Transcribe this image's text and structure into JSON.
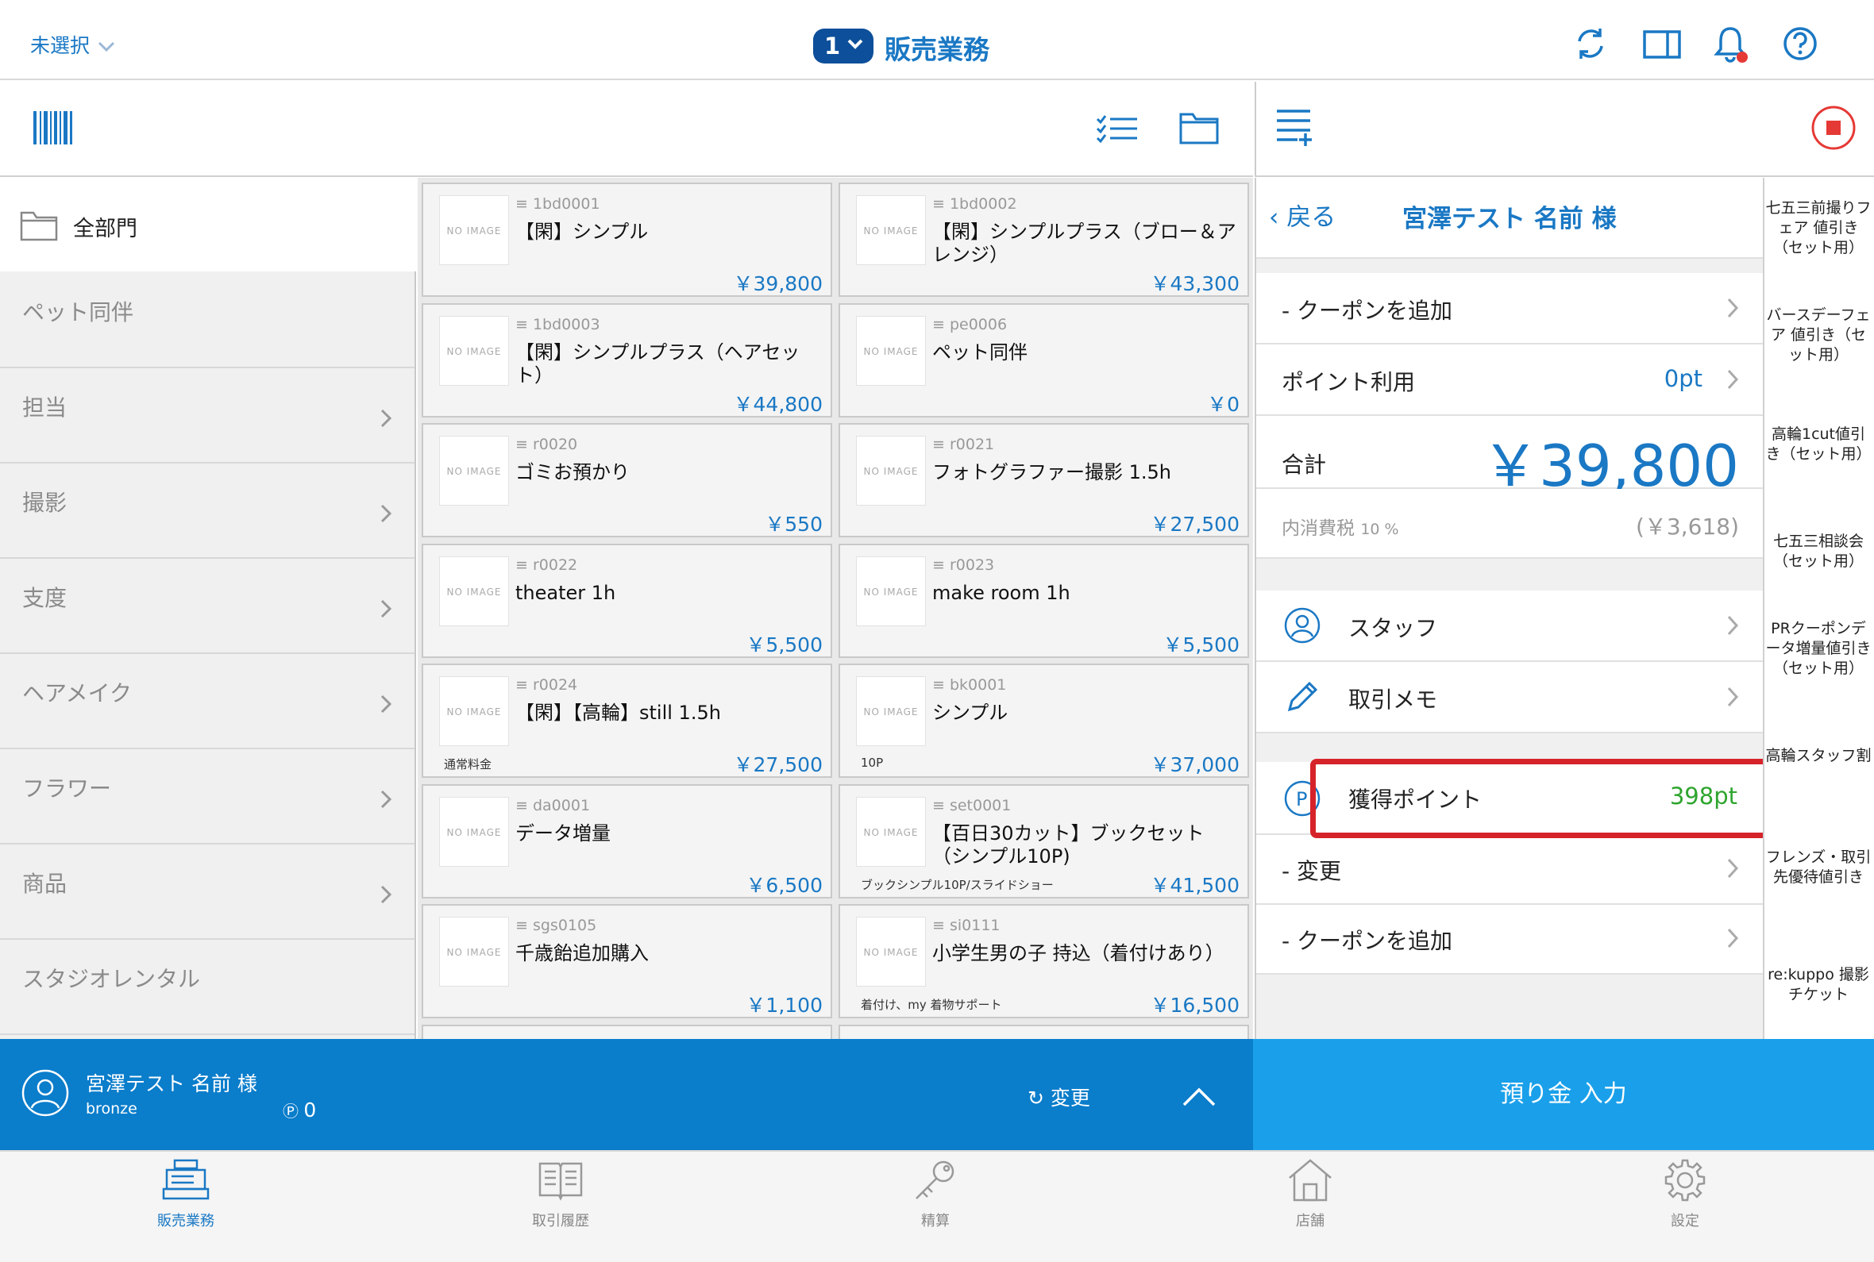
{
  "header": {
    "store_select": "未選択",
    "register_no": "1",
    "title": "販売業務"
  },
  "categories": {
    "all_label": "全部門",
    "items": [
      {
        "label": "ペット同伴",
        "chevron": false
      },
      {
        "label": "担当",
        "chevron": true
      },
      {
        "label": "撮影",
        "chevron": true
      },
      {
        "label": "支度",
        "chevron": true
      },
      {
        "label": "ヘアメイク",
        "chevron": true
      },
      {
        "label": "フラワー",
        "chevron": true
      },
      {
        "label": "商品",
        "chevron": true
      },
      {
        "label": "スタジオレンタル",
        "chevron": false
      }
    ]
  },
  "products": [
    {
      "code": "1bd0001",
      "name": "【閑】シンプル",
      "sub": "",
      "price": "￥39,800",
      "no_image": "NO IMAGE"
    },
    {
      "code": "1bd0002",
      "name": "【閑】シンプルプラス（ブロー＆アレンジ）",
      "sub": "",
      "price": "￥43,300",
      "no_image": "NO IMAGE"
    },
    {
      "code": "1bd0003",
      "name": "【閑】シンプルプラス（ヘアセット）",
      "sub": "",
      "price": "￥44,800",
      "no_image": "NO IMAGE"
    },
    {
      "code": "pe0006",
      "name": "ペット同伴",
      "sub": "",
      "price": "￥0",
      "no_image": "NO IMAGE"
    },
    {
      "code": "r0020",
      "name": "ゴミお預かり",
      "sub": "",
      "price": "￥550",
      "no_image": "NO IMAGE"
    },
    {
      "code": "r0021",
      "name": "フォトグラファー撮影 1.5h",
      "sub": "",
      "price": "￥27,500",
      "no_image": "NO IMAGE"
    },
    {
      "code": "r0022",
      "name": "theater 1h",
      "sub": "",
      "price": "￥5,500",
      "no_image": "NO IMAGE"
    },
    {
      "code": "r0023",
      "name": "make room 1h",
      "sub": "",
      "price": "￥5,500",
      "no_image": "NO IMAGE"
    },
    {
      "code": "r0024",
      "name": "【閑】【高輪】still 1.5h",
      "sub": "通常料金",
      "price": "￥27,500",
      "no_image": "NO IMAGE"
    },
    {
      "code": "bk0001",
      "name": "シンプル",
      "sub": "10P",
      "price": "￥37,000",
      "no_image": "NO IMAGE"
    },
    {
      "code": "da0001",
      "name": "データ増量",
      "sub": "",
      "price": "￥6,500",
      "no_image": "NO IMAGE"
    },
    {
      "code": "set0001",
      "name": "【百日30カット】ブックセット（シンプル10P)",
      "sub": "ブックシンプル10P/スライドショー",
      "price": "￥41,500",
      "no_image": "NO IMAGE"
    },
    {
      "code": "sgs0105",
      "name": "千歳飴追加購入",
      "sub": "",
      "price": "￥1,100",
      "no_image": "NO IMAGE"
    },
    {
      "code": "si0111",
      "name": "小学生男の子 持込（着付けあり）",
      "sub": "着付け、my 着物サポート",
      "price": "￥16,500",
      "no_image": "NO IMAGE"
    }
  ],
  "customer": {
    "name": "宮澤テスト 名前 様",
    "rank": "bronze",
    "points": "0",
    "change_label": "変更"
  },
  "cart": {
    "back_label": "戻る",
    "customer_title": "宮澤テスト 名前 様",
    "coupon_add_1": "- クーポンを追加",
    "points_use_label": "ポイント利用",
    "points_use_value": "0pt",
    "total_label": "合計",
    "total_value": "￥39,800",
    "tax_label": "内消費税",
    "tax_rate": "10 %",
    "tax_value": "(￥3,618)",
    "staff_label": "スタッフ",
    "memo_label": "取引メモ",
    "earned_label": "獲得ポイント",
    "earned_value": "398pt",
    "change_label": "- 変更",
    "coupon_add_2": "- クーポンを追加",
    "deposit_label": "預り金 入力"
  },
  "presets": [
    "七五三前撮りフェア 値引き（セット用）",
    "バースデーフェア 値引き（セット用）",
    "高輪1cut値引き（セット用）",
    "七五三相談会（セット用）",
    "PRクーポンデータ増量値引き（セット用）",
    "高輪スタッフ割",
    "フレンズ・取引先優待値引き",
    "re:kuppo 撮影チケット"
  ],
  "tabs": [
    {
      "label": "販売業務",
      "icon": "register-icon",
      "active": true
    },
    {
      "label": "取引履歴",
      "icon": "book-icon",
      "active": false
    },
    {
      "label": "精算",
      "icon": "key-icon",
      "active": false
    },
    {
      "label": "店舗",
      "icon": "store-icon",
      "active": false
    },
    {
      "label": "設定",
      "icon": "gear-icon",
      "active": false
    }
  ],
  "colors": {
    "accent": "#1a78c4",
    "bar": "#0a7dcb",
    "deposit": "#1aa0ea",
    "earned": "#2ea52e",
    "highlight": "#d6232a",
    "alert": "#e53935"
  }
}
